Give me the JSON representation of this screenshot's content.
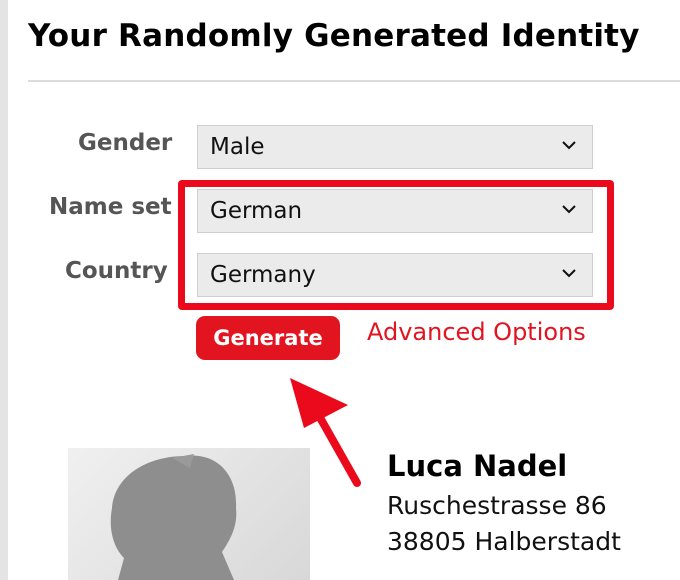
{
  "page": {
    "title": "Your Randomly Generated Identity"
  },
  "form": {
    "gender": {
      "label": "Gender",
      "value": "Male"
    },
    "name_set": {
      "label": "Name set",
      "value": "German"
    },
    "country": {
      "label": "Country",
      "value": "Germany"
    },
    "generate_label": "Generate",
    "advanced_options_label": "Advanced Options"
  },
  "identity": {
    "name": "Luca Nadel",
    "street": "Ruschestrasse 86",
    "city_line": "38805 Halberstadt"
  },
  "colors": {
    "accent": "#e2141f",
    "highlight": "#ea0a1b",
    "select_bg": "#ebebeb",
    "label": "#555555"
  },
  "icons": [
    "chevron-down-icon",
    "person-silhouette-icon",
    "annotation-arrow"
  ]
}
